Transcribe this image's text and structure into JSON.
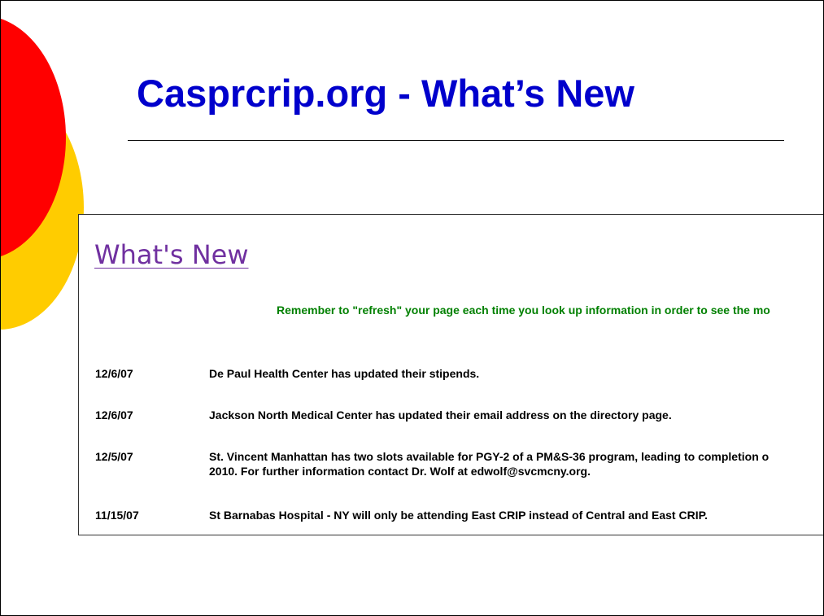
{
  "slide": {
    "title": "Casprcrip.org - What’s New",
    "colors": {
      "title": "#0000cc",
      "circle_red": "#ff0000",
      "circle_yellow": "#ffcc00"
    }
  },
  "webpage": {
    "heading": "What's New",
    "heading_color": "#7030a0",
    "refresh_note": "Remember to \"refresh\" your page each time you look up information in order to see the mo",
    "refresh_note_color": "#008000",
    "items": [
      {
        "date": "12/6/07",
        "lines": [
          "De Paul Health Center has updated their stipends."
        ]
      },
      {
        "date": "12/6/07",
        "lines": [
          "Jackson North Medical Center has updated their email address on the directory page."
        ]
      },
      {
        "date": "12/5/07",
        "lines": [
          "St. Vincent Manhattan has two slots available for PGY-2 of a PM&S-36 program, leading to completion o",
          "2010.  For further information contact Dr. Wolf at edwolf@svcmcny.org."
        ]
      },
      {
        "date": "11/15/07",
        "lines": [
          "St Barnabas Hospital - NY will only be attending East CRIP instead of Central and East CRIP."
        ]
      }
    ]
  }
}
